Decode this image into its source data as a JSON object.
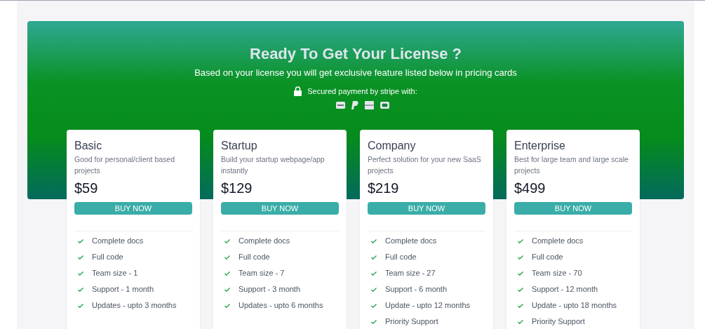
{
  "banner": {
    "title": "Ready To Get Your License ?",
    "subtitle": "Based on your license you will get exclusive feature listed below in pricing cards",
    "secure_note": "Secured payment by stripe with:",
    "payment_methods": [
      {
        "kind": "visa"
      },
      {
        "kind": "paypal"
      },
      {
        "kind": "bank"
      },
      {
        "kind": "mastercard"
      }
    ]
  },
  "plans": [
    {
      "name": "Basic",
      "description": "Good for personal/client based projects",
      "price": "$59",
      "button": "BUY NOW",
      "features": [
        "Complete docs",
        "Full code",
        "Team size - 1",
        "Support - 1 month",
        "Updates - upto 3 months"
      ]
    },
    {
      "name": "Startup",
      "description": "Build your startup webpage/app instantly",
      "price": "$129",
      "button": "BUY NOW",
      "features": [
        "Complete docs",
        "Full code",
        "Team size - 7",
        "Support - 3 month",
        "Updates - upto 6 months"
      ]
    },
    {
      "name": "Company",
      "description": "Perfect solution for your new SaaS projects",
      "price": "$219",
      "button": "BUY NOW",
      "features": [
        "Complete docs",
        "Full code",
        "Team size - 27",
        "Support - 6 month",
        "Update - upto 12 months",
        "Priority Support"
      ]
    },
    {
      "name": "Enterprise",
      "description": "Best for large team and large scale projects",
      "price": "$499",
      "button": "BUY NOW",
      "features": [
        "Complete docs",
        "Full code",
        "Team size - 70",
        "Support - 12 month",
        "Update - upto 18 months",
        "Priority Support"
      ]
    }
  ]
}
